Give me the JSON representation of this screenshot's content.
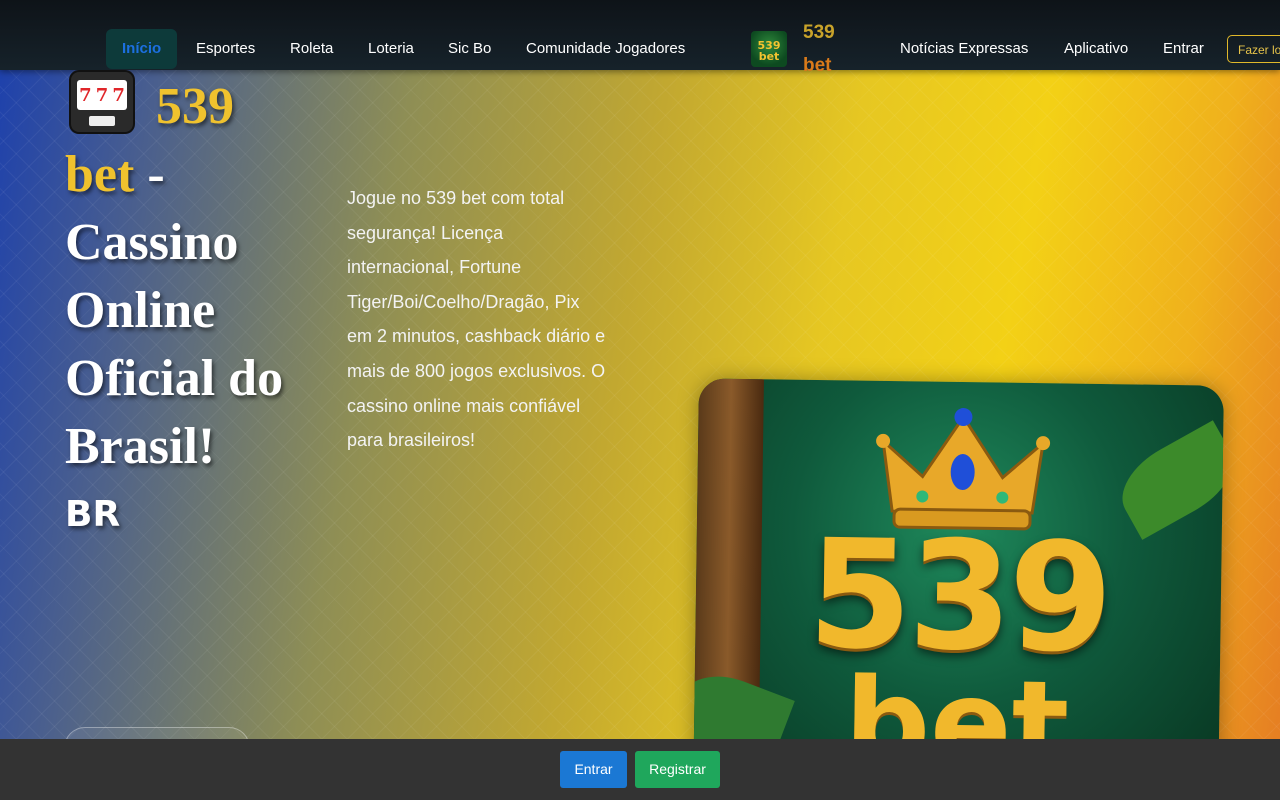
{
  "nav": {
    "items": [
      {
        "label": "Início",
        "active": true
      },
      {
        "label": "Esportes"
      },
      {
        "label": "Roleta"
      },
      {
        "label": "Loteria"
      },
      {
        "label": "Sic Bo"
      },
      {
        "label": "Comunidade Jogadores"
      }
    ],
    "brand_line1": "539",
    "brand_line2": "bet",
    "items_right": [
      {
        "label": "Notícias Expressas"
      },
      {
        "label": "Aplicativo"
      },
      {
        "label": "Entrar"
      }
    ],
    "login_button": "Fazer login",
    "logo_text1": "539",
    "logo_text2": "bet"
  },
  "hero": {
    "title_gold1": "539",
    "title_gold2": "bet",
    "title_rest": " - Cassino Online Oficial do Brasil!",
    "title_suffix": "BR",
    "description": "Jogue no 539 bet com total segurança! Licença internacional, Fortune Tiger/Boi/Coelho/Dragão, Pix em 2 minutos, cashback diário e mais de 800 jogos exclusivos. O cassino online mais confiável para brasileiros!",
    "image_text1": "539",
    "image_text2": "bet",
    "slot_reels": "777"
  },
  "bottom_bar": {
    "login_label": "Entrar",
    "register_label": "Registrar"
  },
  "colors": {
    "accent_gold": "#f0c22e",
    "entrar_blue": "#1b78d4",
    "registrar_green": "#1fa75c"
  }
}
